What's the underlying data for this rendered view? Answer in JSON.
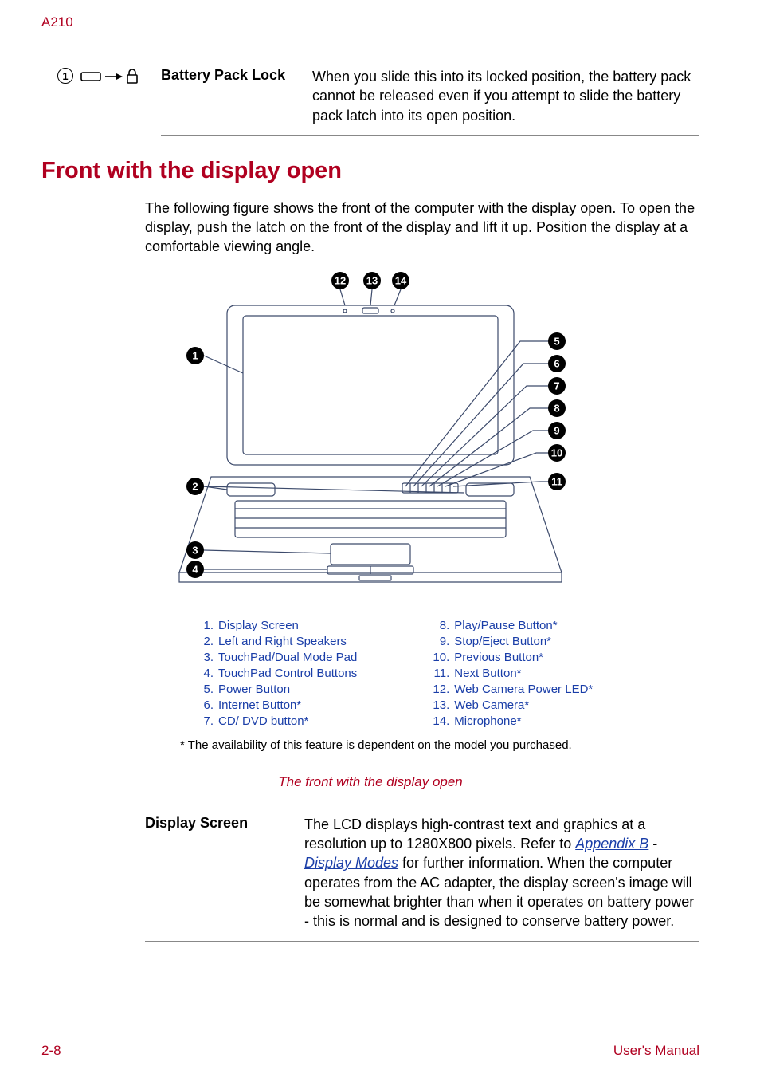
{
  "header": {
    "model": "A210"
  },
  "battery_lock_row": {
    "icon_num": "1",
    "label": "Battery Pack Lock",
    "desc": "When you slide this into its locked position, the battery pack cannot be released even if you attempt to slide the battery pack latch into its open position."
  },
  "section_heading": "Front with the display open",
  "intro": "The following figure shows the front of the computer with the display open. To open the display, push the latch on the front of the display and lift it up. Position the display at a comfortable viewing angle.",
  "figure": {
    "badges_top": [
      "12",
      "13",
      "14"
    ],
    "badges_left": [
      "1",
      "2",
      "3",
      "4"
    ],
    "badges_right": [
      "5",
      "6",
      "7",
      "8",
      "9",
      "10",
      "11"
    ]
  },
  "legend": {
    "left": [
      {
        "n": "1.",
        "t": "Display Screen"
      },
      {
        "n": "2.",
        "t": "Left and Right Speakers"
      },
      {
        "n": "3.",
        "t": "TouchPad/Dual Mode Pad"
      },
      {
        "n": "4.",
        "t": "TouchPad Control Buttons"
      },
      {
        "n": "5.",
        "t": "Power Button"
      },
      {
        "n": "6.",
        "t": "Internet Button*"
      },
      {
        "n": "7.",
        "t": "CD/ DVD button*"
      }
    ],
    "right": [
      {
        "n": "8.",
        "t": "Play/Pause Button*"
      },
      {
        "n": "9.",
        "t": "Stop/Eject Button*"
      },
      {
        "n": "10.",
        "t": "Previous Button*"
      },
      {
        "n": "11.",
        "t": "Next Button*"
      },
      {
        "n": "12.",
        "t": "Web Camera Power LED*"
      },
      {
        "n": "13.",
        "t": "Web Camera*"
      },
      {
        "n": "14.",
        "t": "Microphone*"
      }
    ]
  },
  "footnote": "* The availability of this feature is dependent on the model you purchased.",
  "caption": "The front with the display open",
  "display_row": {
    "label": "Display Screen",
    "desc_pre": "The LCD displays high-contrast text and graphics at a resolution up to 1280X800 pixels. Refer to ",
    "link1": "Appendix B",
    "dash": " - ",
    "link2": "Display Modes",
    "desc_post": " for further information. When the computer operates from the AC adapter, the display screen's image will be somewhat brighter than when it operates on battery power - this is normal and is designed to conserve battery power."
  },
  "footer": {
    "page": "2-8",
    "manual": "User's Manual"
  }
}
